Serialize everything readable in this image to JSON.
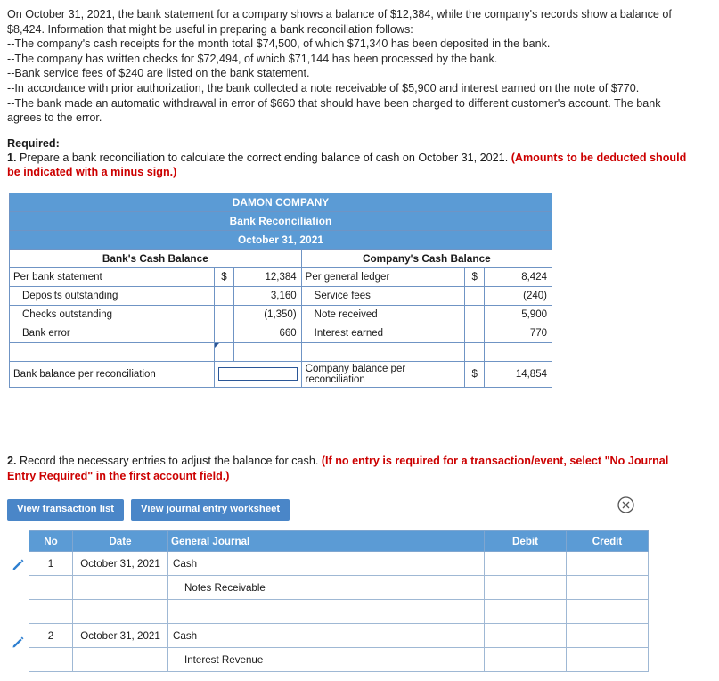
{
  "problem": {
    "lines": [
      "On October 31, 2021, the bank statement for a company shows a balance of $12,384, while the company's records show a balance of",
      "$8,424. Information that might be useful in preparing a bank reconciliation follows:",
      "--The company's cash receipts for the month total $74,500, of which $71,340 has been deposited in the bank.",
      "--The company has written checks for $72,494, of which $71,144 has been processed by the bank.",
      "--Bank service fees of $240 are listed on the bank statement.",
      "--In accordance with prior authorization, the bank collected a note receivable of $5,900 and interest earned on the note of $770.",
      "--The bank made an automatic withdrawal in error of $660 that should have been charged to different customer's account. The bank",
      "agrees to the error."
    ]
  },
  "required": {
    "heading": "Required:",
    "item1_num": "1.",
    "item1_text": " Prepare a bank reconciliation to calculate the correct ending balance of cash on October 31, 2021. ",
    "item1_red": "(Amounts to be deducted should",
    "item1_red2": "be indicated with a minus sign.)"
  },
  "recon": {
    "title1": "DAMON COMPANY",
    "title2": "Bank Reconciliation",
    "title3": "October 31, 2021",
    "col_head_left": "Bank's Cash Balance",
    "col_head_right": "Company's Cash Balance",
    "rows": [
      {
        "left_label": "Per bank statement",
        "left_cur": "$",
        "left_amt": "12,384",
        "right_label": "Per general ledger",
        "right_cur": "$",
        "right_amt": "8,424"
      },
      {
        "left_label": "Deposits outstanding",
        "left_cur": "",
        "left_amt": "3,160",
        "right_label": "Service fees",
        "right_cur": "",
        "right_amt": "(240)"
      },
      {
        "left_label": "Checks outstanding",
        "left_cur": "",
        "left_amt": "(1,350)",
        "right_label": "Note received",
        "right_cur": "",
        "right_amt": "5,900"
      },
      {
        "left_label": "Bank error",
        "left_cur": "",
        "left_amt": "660",
        "right_label": "Interest earned",
        "right_cur": "",
        "right_amt": "770"
      },
      {
        "left_label": "",
        "left_cur": "",
        "left_amt": "",
        "right_label": "",
        "right_cur": "",
        "right_amt": ""
      }
    ],
    "total_left_label": "Bank balance per reconciliation",
    "total_right_label": "Company balance per reconciliation",
    "total_right_cur": "$",
    "total_right_amt": "14,854"
  },
  "section2": {
    "num": "2.",
    "text": " Record the necessary entries to adjust the balance for cash. ",
    "red1": "(If no entry is required for a transaction/event, select \"No Journal",
    "red2": "Entry Required\" in the first account field.)",
    "btn_transaction_list": "View transaction list",
    "btn_journal_worksheet": "View journal entry worksheet",
    "close_icon": "circle-x-icon"
  },
  "journal": {
    "headers": [
      "No",
      "Date",
      "General Journal",
      "Debit",
      "Credit"
    ],
    "rows": [
      {
        "no": "1",
        "date": "October 31, 2021",
        "account": "Cash",
        "indent": false,
        "debit": "",
        "credit": "",
        "edit": true
      },
      {
        "no": "",
        "date": "",
        "account": "Notes Receivable",
        "indent": true,
        "debit": "",
        "credit": "",
        "edit": false
      },
      {
        "no": "",
        "date": "",
        "account": "",
        "indent": false,
        "debit": "",
        "credit": "",
        "edit": false
      },
      {
        "no": "2",
        "date": "October 31, 2021",
        "account": "Cash",
        "indent": false,
        "debit": "",
        "credit": "",
        "edit": true
      },
      {
        "no": "",
        "date": "",
        "account": "Interest Revenue",
        "indent": true,
        "debit": "",
        "credit": "",
        "edit": false
      }
    ]
  },
  "colors": {
    "header_blue": "#5b9bd5",
    "button_blue": "#4a86c8",
    "red": "#cc0000"
  }
}
